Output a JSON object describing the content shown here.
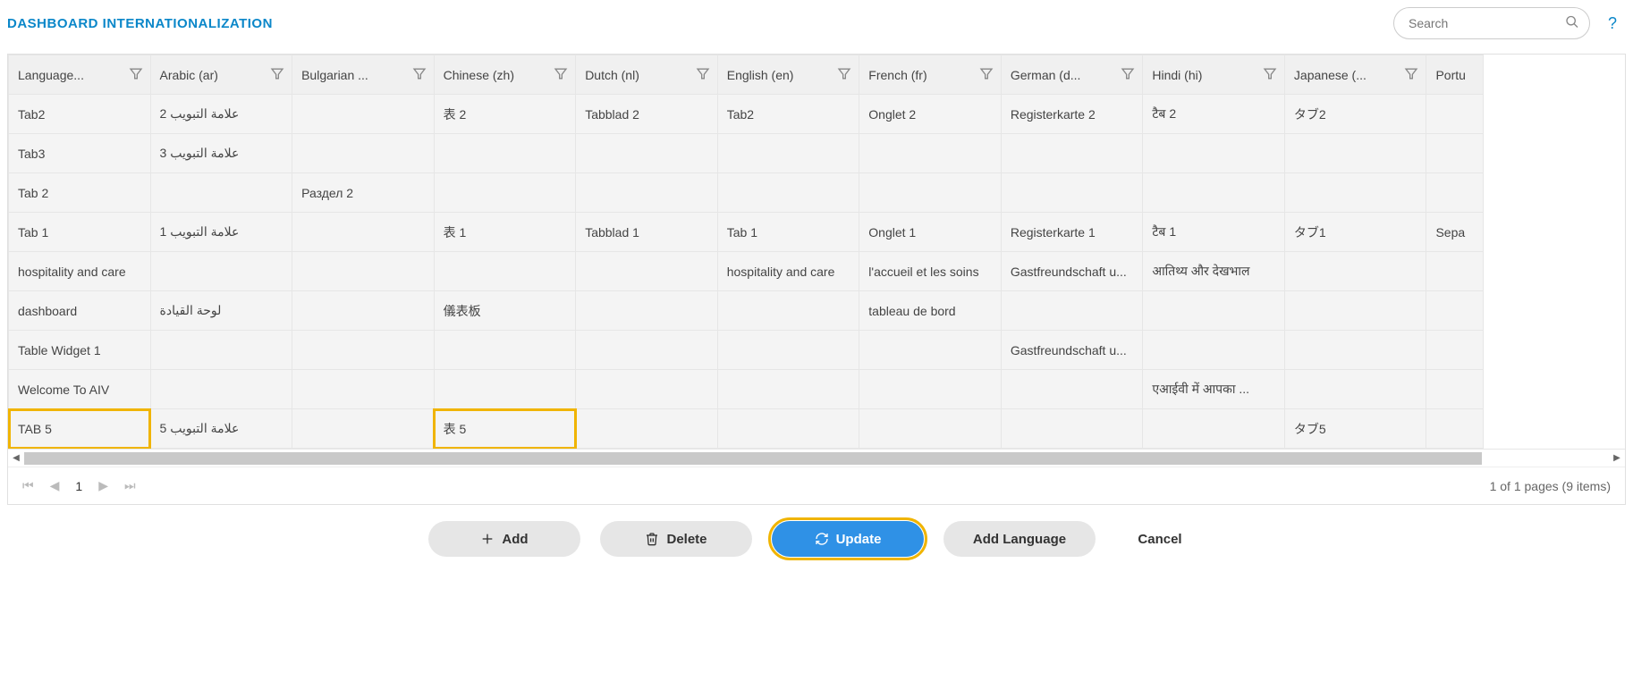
{
  "header": {
    "title": "DASHBOARD INTERNATIONALIZATION",
    "search_placeholder": "Search"
  },
  "columns": [
    {
      "key": "lang",
      "label": "Language..."
    },
    {
      "key": "ar",
      "label": "Arabic (ar)"
    },
    {
      "key": "bg",
      "label": "Bulgarian ..."
    },
    {
      "key": "zh",
      "label": "Chinese (zh)"
    },
    {
      "key": "nl",
      "label": "Dutch (nl)"
    },
    {
      "key": "en",
      "label": "English (en)"
    },
    {
      "key": "fr",
      "label": "French (fr)"
    },
    {
      "key": "de",
      "label": "German (d..."
    },
    {
      "key": "hi",
      "label": "Hindi (hi)"
    },
    {
      "key": "ja",
      "label": "Japanese (..."
    },
    {
      "key": "pt",
      "label": "Portu"
    }
  ],
  "rows": [
    {
      "lang": "Tab2",
      "ar": "علامة التبويب 2",
      "bg": "",
      "zh": "表 2",
      "nl": "Tabblad 2",
      "en": "Tab2",
      "fr": "Onglet 2",
      "de": "Registerkarte 2",
      "hi": "टैब 2",
      "ja": "タブ2",
      "pt": ""
    },
    {
      "lang": "Tab3",
      "ar": "علامة التبويب 3",
      "bg": "",
      "zh": "",
      "nl": "",
      "en": "",
      "fr": "",
      "de": "",
      "hi": "",
      "ja": "",
      "pt": ""
    },
    {
      "lang": "Tab 2",
      "ar": "",
      "bg": "Раздел 2",
      "zh": "",
      "nl": "",
      "en": "",
      "fr": "",
      "de": "",
      "hi": "",
      "ja": "",
      "pt": ""
    },
    {
      "lang": "Tab 1",
      "ar": "علامة التبويب 1",
      "bg": "",
      "zh": "表 1",
      "nl": "Tabblad 1",
      "en": "Tab 1",
      "fr": "Onglet 1",
      "de": "Registerkarte 1",
      "hi": "टैब 1",
      "ja": "タブ1",
      "pt": "Sepa"
    },
    {
      "lang": "hospitality and care",
      "ar": "",
      "bg": "",
      "zh": "",
      "nl": "",
      "en": "hospitality and care",
      "fr": "l'accueil et les soins",
      "de": "Gastfreundschaft u...",
      "hi": "आतिथ्य और देखभाल",
      "ja": "",
      "pt": ""
    },
    {
      "lang": "dashboard",
      "ar": "لوحة القيادة",
      "bg": "",
      "zh": "儀表板",
      "nl": "",
      "en": "",
      "fr": "tableau de bord",
      "de": "",
      "hi": "",
      "ja": "",
      "pt": ""
    },
    {
      "lang": "Table Widget 1",
      "ar": "",
      "bg": "",
      "zh": "",
      "nl": "",
      "en": "",
      "fr": "",
      "de": "Gastfreundschaft u...",
      "hi": "",
      "ja": "",
      "pt": ""
    },
    {
      "lang": "Welcome To AIV",
      "ar": "",
      "bg": "",
      "zh": "",
      "nl": "",
      "en": "",
      "fr": "",
      "de": "",
      "hi": "एआईवी में आपका ...",
      "ja": "",
      "pt": ""
    },
    {
      "lang": "TAB 5",
      "ar": "علامة التبويب 5",
      "bg": "",
      "zh": "表 5",
      "nl": "",
      "en": "",
      "fr": "",
      "de": "",
      "hi": "",
      "ja": "タブ5",
      "pt": "",
      "hl": [
        "lang",
        "zh"
      ]
    }
  ],
  "pager": {
    "current": "1",
    "summary": "1 of 1 pages (9 items)"
  },
  "footer": {
    "add": "Add",
    "delete": "Delete",
    "update": "Update",
    "add_language": "Add Language",
    "cancel": "Cancel"
  }
}
